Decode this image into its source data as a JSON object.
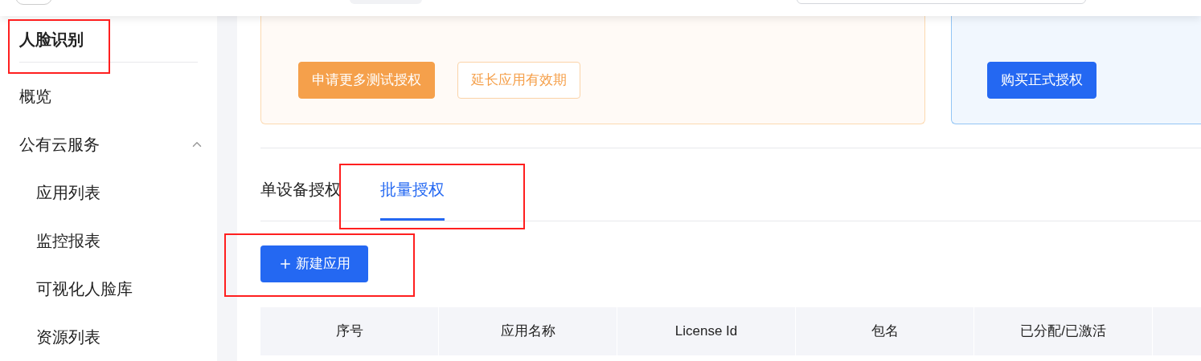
{
  "sidebar": {
    "title": "人脸识别",
    "items": [
      {
        "label": "概览",
        "kind": "link"
      },
      {
        "label": "公有云服务",
        "kind": "group",
        "expanded": true,
        "children": [
          {
            "label": "应用列表"
          },
          {
            "label": "监控报表"
          },
          {
            "label": "可视化人脸库"
          },
          {
            "label": "资源列表"
          }
        ]
      }
    ]
  },
  "trial_card": {
    "buttons": [
      {
        "label": "申请更多测试授权",
        "kind": "primary"
      },
      {
        "label": "延长应用有效期",
        "kind": "outline"
      }
    ]
  },
  "formal_card": {
    "buttons": [
      {
        "label": "购买正式授权",
        "kind": "primary"
      }
    ]
  },
  "tabs": [
    {
      "label": "单设备授权",
      "selected": false
    },
    {
      "label": "批量授权",
      "selected": true
    }
  ],
  "new_button": {
    "label": "新建应用"
  },
  "table": {
    "columns": [
      "序号",
      "应用名称",
      "License Id",
      "包名",
      "已分配/已激活"
    ]
  }
}
